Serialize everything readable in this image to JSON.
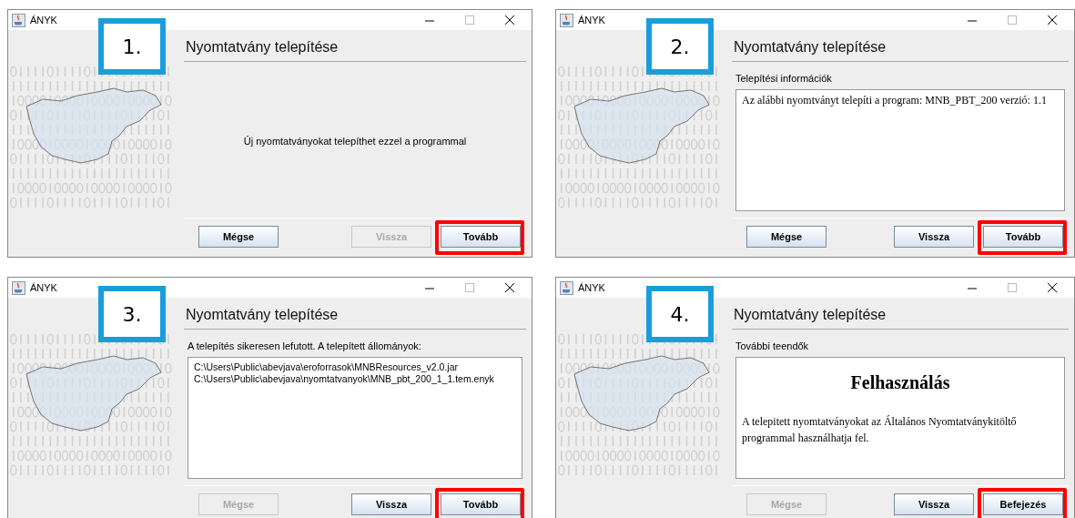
{
  "windows": [
    {
      "title": "ÁNYK",
      "step": "1.",
      "heading": "Nyomtatvány telepítése",
      "content": {
        "kind": "message",
        "text": "Új nyomtatványokat telepíthet ezzel a programmal"
      },
      "buttons": [
        {
          "label": "Mégse",
          "disabled": false,
          "highlighted": false
        },
        {
          "label": "Vissza",
          "disabled": true,
          "highlighted": false
        },
        {
          "label": "Tovább",
          "disabled": false,
          "highlighted": true
        }
      ]
    },
    {
      "title": "ÁNYK",
      "step": "2.",
      "heading": "Nyomtatvány telepítése",
      "content": {
        "kind": "info",
        "label": "Telepítési információk",
        "text": "Az alábbi nyomtványt telepíti a program: MNB_PBT_200 verzió: 1.1"
      },
      "buttons": [
        {
          "label": "Mégse",
          "disabled": false,
          "highlighted": false
        },
        {
          "label": "Vissza",
          "disabled": false,
          "highlighted": false
        },
        {
          "label": "Tovább",
          "disabled": false,
          "highlighted": true
        }
      ]
    },
    {
      "title": "ÁNYK",
      "step": "3.",
      "heading": "Nyomtatvány telepítése",
      "content": {
        "kind": "list",
        "label": "A telepítés sikeresen lefutott. A telepített állományok:",
        "lines": [
          "C:\\Users\\Public\\abevjava\\eroforrasok\\MNBResources_v2.0.jar",
          "C:\\Users\\Public\\abevjava\\nyomtatvanyok\\MNB_pbt_200_1_1.tem.enyk"
        ]
      },
      "buttons": [
        {
          "label": "Mégse",
          "disabled": true,
          "highlighted": false
        },
        {
          "label": "Vissza",
          "disabled": false,
          "highlighted": false
        },
        {
          "label": "Tovább",
          "disabled": false,
          "highlighted": true
        }
      ]
    },
    {
      "title": "ÁNYK",
      "step": "4.",
      "heading": "Nyomtatvány telepítése",
      "content": {
        "kind": "html",
        "label": "További teendők",
        "heading": "Felhasználás",
        "text": "A telepitett nyomtatványokat az Általános Nyomtatványkitöltő programmal használhatja fel."
      },
      "buttons": [
        {
          "label": "Mégse",
          "disabled": true,
          "highlighted": false
        },
        {
          "label": "Vissza",
          "disabled": false,
          "highlighted": false
        },
        {
          "label": "Befejezés",
          "disabled": false,
          "highlighted": true
        }
      ]
    }
  ]
}
